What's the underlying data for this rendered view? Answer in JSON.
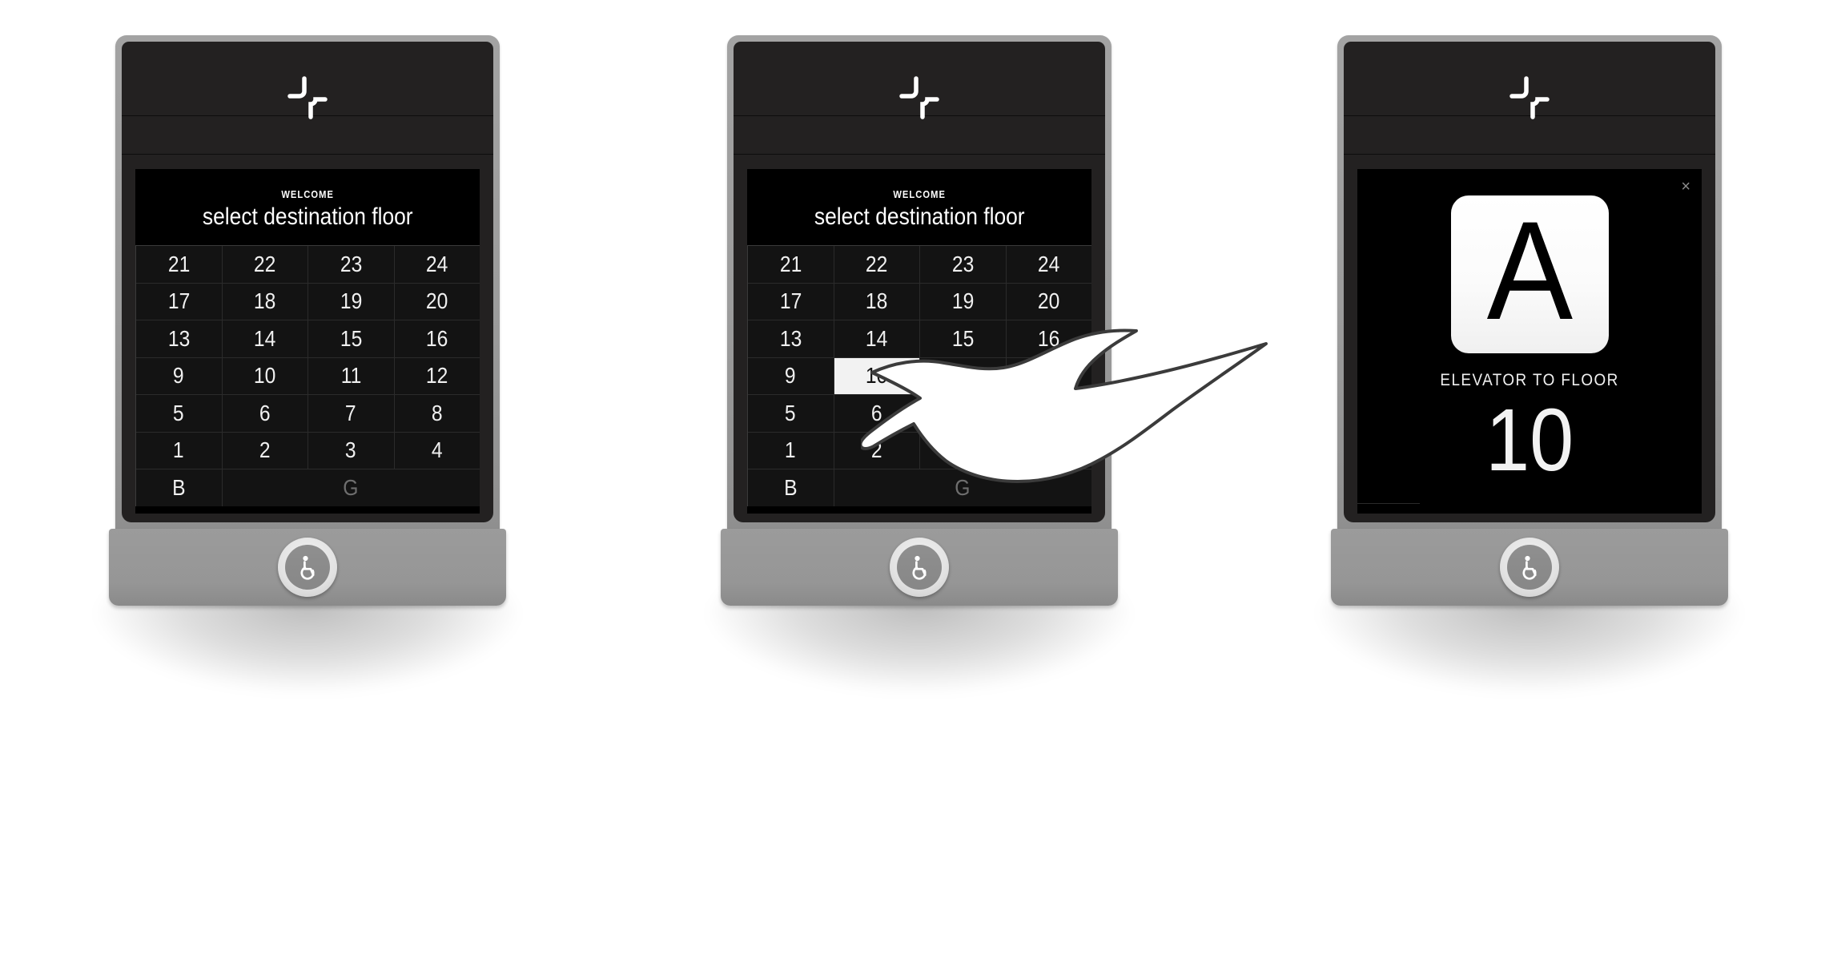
{
  "meta": {
    "scene": "Elevator destination dispatch touch panel — three states",
    "accent_light": "#f2f2f2",
    "accent_dark": "#131313",
    "bezel_color": "#9b9b9b",
    "body_color": "#232121",
    "screen_color": "#000000",
    "disabled_color": "#6e6e6e"
  },
  "branding": {
    "logo_name": "pinwheel-logo"
  },
  "welcome": {
    "eyebrow": "WELCOME",
    "title": "select destination floor"
  },
  "keypad": {
    "rows": [
      [
        "21",
        "22",
        "23",
        "24"
      ],
      [
        "17",
        "18",
        "19",
        "20"
      ],
      [
        "13",
        "14",
        "15",
        "16"
      ],
      [
        "9",
        "10",
        "11",
        "12"
      ],
      [
        "5",
        "6",
        "7",
        "8"
      ],
      [
        "1",
        "2",
        "3",
        "4"
      ]
    ],
    "bottom_row": {
      "basement_label": "B",
      "ground_label": "G",
      "ground_disabled": true
    },
    "selected_key": "10"
  },
  "panels": [
    {
      "id": "panel-idle",
      "state": "idle",
      "screen": "keypad",
      "hand_visible": false
    },
    {
      "id": "panel-selecting",
      "state": "selecting",
      "screen": "keypad",
      "hand_visible": true,
      "pressed_key": "10"
    },
    {
      "id": "panel-confirmed",
      "state": "confirmed",
      "screen": "confirmation",
      "hand_visible": false
    }
  ],
  "confirmation": {
    "close_label": "×",
    "car_letter": "A",
    "label": "ELEVATOR TO FLOOR",
    "floor": "10"
  },
  "accessibility": {
    "button_label": "wheelchair-accessibility"
  }
}
